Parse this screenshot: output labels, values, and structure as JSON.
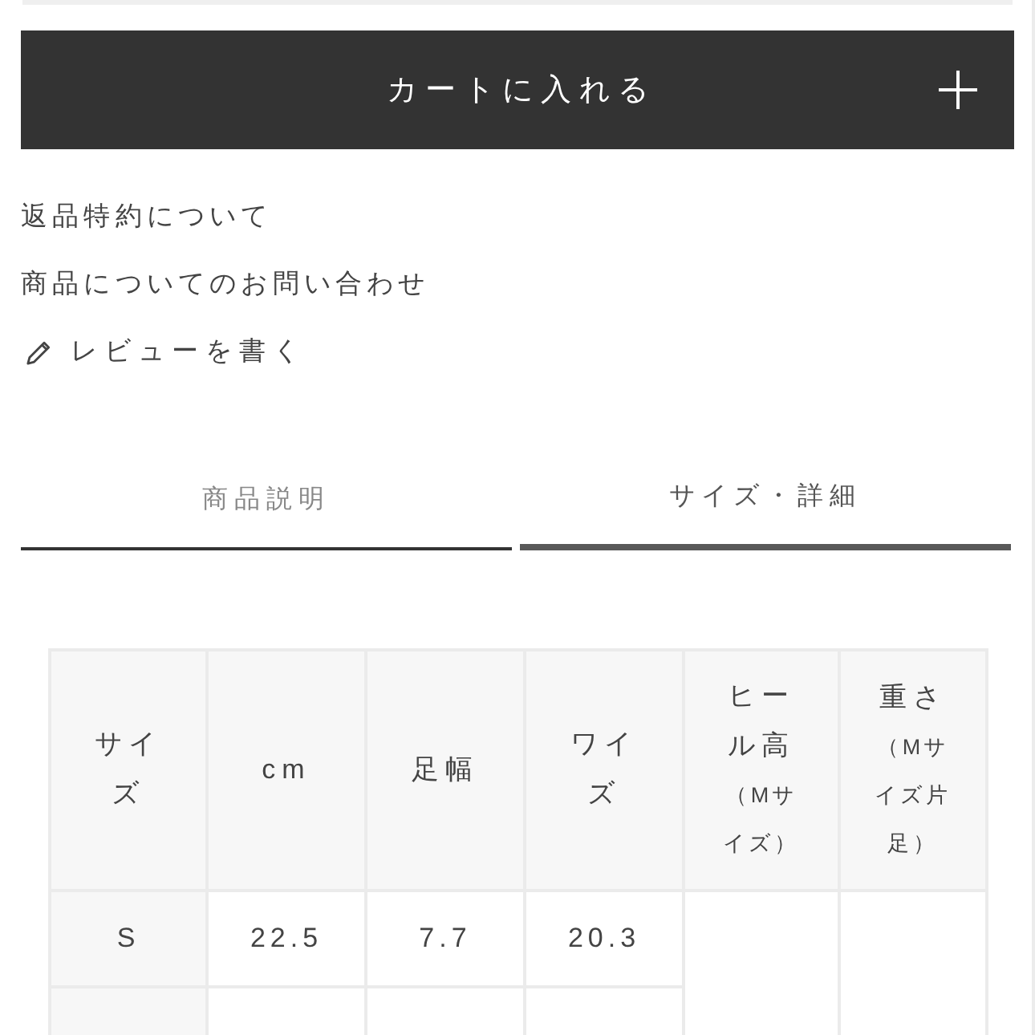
{
  "add_to_cart_button": {
    "label": "カートに入れる"
  },
  "links": [
    {
      "kind": "text",
      "label": "返品特約について"
    },
    {
      "kind": "text",
      "label": "商品についてのお問い合わせ"
    },
    {
      "kind": "review",
      "label": "レビューを書く"
    }
  ],
  "tabs": [
    {
      "label": "商品説明",
      "selected": false
    },
    {
      "label": "サイズ・詳細",
      "selected": true
    }
  ],
  "size_table": {
    "columns": [
      {
        "label": "サイズ"
      },
      {
        "label": "cm"
      },
      {
        "label": "足幅"
      },
      {
        "label": "ワイズ"
      },
      {
        "label": "ヒール高",
        "note": "（Mサイズ）"
      },
      {
        "label": "重さ",
        "note": "（Mサイズ片足）"
      }
    ],
    "rows": [
      {
        "cells": [
          "S",
          "22.5",
          "7.7",
          "20.3"
        ]
      }
    ]
  }
}
